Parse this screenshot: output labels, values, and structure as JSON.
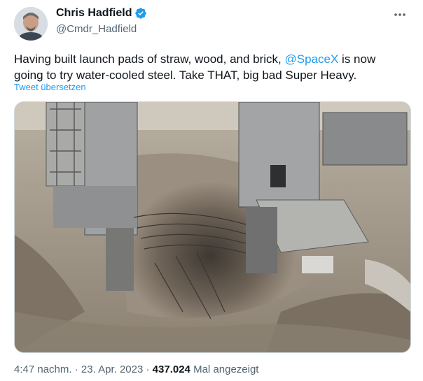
{
  "author": {
    "display_name": "Chris Hadfield",
    "handle": "@Cmdr_Hadfield"
  },
  "tweet": {
    "text_before": "Having built launch pads of straw, wood, and brick, ",
    "mention": "@SpaceX",
    "text_after": " is now going to try water-cooled steel. Take THAT, big bad Super Heavy.",
    "translate_label": "Tweet übersetzen"
  },
  "meta": {
    "time": "4:47 nachm.",
    "separator1": " · ",
    "date": "23. Apr. 2023",
    "separator2": " · ",
    "views_count": "437.024",
    "views_label": " Mal angezeigt"
  },
  "icons": {
    "verified": "verified-badge-icon",
    "more": "more-options-icon"
  },
  "colors": {
    "accent": "#1d9bf0",
    "secondary_text": "#536471",
    "primary_text": "#0f1419"
  }
}
